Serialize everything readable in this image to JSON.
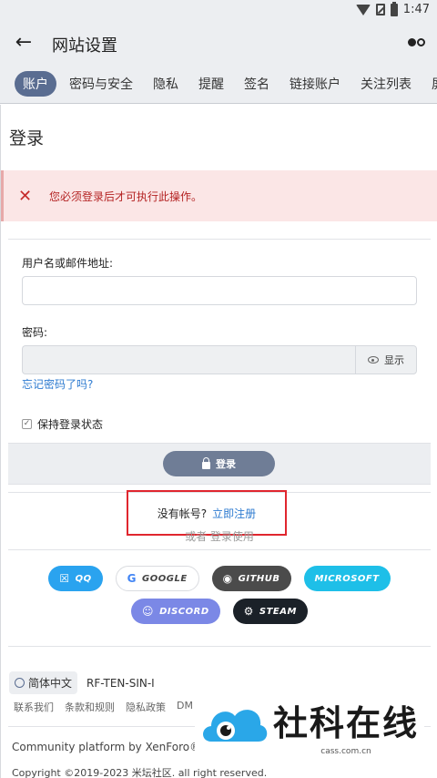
{
  "status_bar": {
    "time": "1:47",
    "icons": [
      "wifi-icon",
      "no-sim-icon",
      "battery-icon"
    ]
  },
  "app_bar": {
    "back_icon": "arrow-left-icon",
    "title": "网站设置",
    "menu_icon": "more-menu-icon"
  },
  "tabs": [
    {
      "label": "账户",
      "active": true
    },
    {
      "label": "密码与安全"
    },
    {
      "label": "隐私"
    },
    {
      "label": "提醒"
    },
    {
      "label": "签名"
    },
    {
      "label": "链接账户"
    },
    {
      "label": "关注列表"
    },
    {
      "label": "屏蔽"
    }
  ],
  "login": {
    "title": "登录",
    "error_message": "您必须登录后才可执行此操作。",
    "username_label": "用户名或邮件地址:",
    "username_value": "",
    "password_label": "密码:",
    "password_value": "",
    "show_label": "显示",
    "forgot_link": "忘记密码了吗?",
    "remember_label": "保持登录状态",
    "remember_checked": true,
    "submit_label": "登录"
  },
  "register": {
    "prompt": "没有帐号?",
    "link": "立即注册"
  },
  "alt_login": {
    "or_text": "或者  登录使用",
    "providers_row1": [
      {
        "label": "QQ",
        "icon": "qq-icon"
      },
      {
        "label": "GOOGLE",
        "icon": "google-icon"
      },
      {
        "label": "GITHUB",
        "icon": "github-icon"
      },
      {
        "label": "MICROSOFT",
        "icon": "microsoft-icon"
      }
    ],
    "providers_row2": [
      {
        "label": "DISCORD",
        "icon": "discord-icon"
      },
      {
        "label": "STEAM",
        "icon": "steam-icon"
      }
    ]
  },
  "footer": {
    "language": "简体中文",
    "style": "RF-TEN-SIN-I",
    "links": [
      "联系我们",
      "条款和规则",
      "隐私政策",
      "DM"
    ],
    "powered_by": "Community platform by XenForo® © 2",
    "copyright": "Copyright ©2019-2023 米坛社区. all right reserved."
  },
  "watermark": {
    "brand": "社科在线",
    "domain": "cass.com.cn"
  },
  "colors": {
    "accent": "#5a6d91",
    "error": "#b42323",
    "link": "#2e7bd0",
    "highlight_box": "#e0262e"
  }
}
